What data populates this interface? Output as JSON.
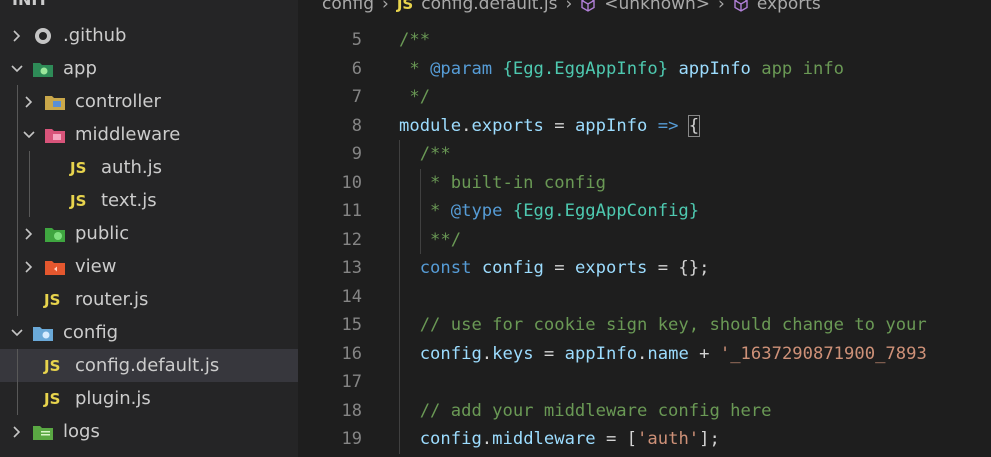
{
  "sidebar": {
    "header": "INIT",
    "items": [
      {
        "label": ".github",
        "kind": "folder",
        "icon": "github-folder-icon",
        "expanded": false,
        "depth": 0
      },
      {
        "label": "app",
        "kind": "folder",
        "icon": "app-folder-icon",
        "expanded": true,
        "depth": 0
      },
      {
        "label": "controller",
        "kind": "folder",
        "icon": "controller-folder-icon",
        "expanded": false,
        "depth": 1
      },
      {
        "label": "middleware",
        "kind": "folder",
        "icon": "middleware-folder-icon",
        "expanded": true,
        "depth": 1
      },
      {
        "label": "auth.js",
        "kind": "file",
        "icon": "js-file-icon",
        "depth": 2
      },
      {
        "label": "text.js",
        "kind": "file",
        "icon": "js-file-icon",
        "depth": 2
      },
      {
        "label": "public",
        "kind": "folder",
        "icon": "public-folder-icon",
        "expanded": false,
        "depth": 1
      },
      {
        "label": "view",
        "kind": "folder",
        "icon": "view-folder-icon",
        "expanded": false,
        "depth": 1
      },
      {
        "label": "router.js",
        "kind": "file",
        "icon": "js-file-icon",
        "depth": 1
      },
      {
        "label": "config",
        "kind": "folder",
        "icon": "config-folder-icon",
        "expanded": true,
        "depth": 0
      },
      {
        "label": "config.default.js",
        "kind": "file",
        "icon": "js-file-icon",
        "depth": 1,
        "selected": true
      },
      {
        "label": "plugin.js",
        "kind": "file",
        "icon": "js-file-icon",
        "depth": 1
      },
      {
        "label": "logs",
        "kind": "folder",
        "icon": "logs-folder-icon",
        "expanded": false,
        "depth": 0
      }
    ],
    "js_badge": "JS"
  },
  "breadcrumb": {
    "folder": "config",
    "file_badge": "JS",
    "file": "config.default.js",
    "symbol1": "<unknown>",
    "symbol2": "exports"
  },
  "editor": {
    "line_numbers": [
      "5",
      "6",
      "7",
      "8",
      "9",
      "10",
      "11",
      "12",
      "13",
      "14",
      "15",
      "16",
      "17",
      "18",
      "19"
    ],
    "lines": [
      {
        "indent": "",
        "tokens": [
          {
            "t": "/**",
            "c": "comment"
          }
        ]
      },
      {
        "indent": " ",
        "tokens": [
          {
            "t": "* ",
            "c": "comment"
          },
          {
            "t": "@param",
            "c": "tag"
          },
          {
            "t": " ",
            "c": "comment"
          },
          {
            "t": "{Egg.EggAppInfo}",
            "c": "type"
          },
          {
            "t": " ",
            "c": "comment"
          },
          {
            "t": "appInfo",
            "c": "var"
          },
          {
            "t": " app info",
            "c": "comment"
          }
        ]
      },
      {
        "indent": " ",
        "tokens": [
          {
            "t": "*/",
            "c": "comment"
          }
        ]
      },
      {
        "indent": "",
        "tokens": [
          {
            "t": "module",
            "c": "var"
          },
          {
            "t": ".",
            "c": "plain"
          },
          {
            "t": "exports",
            "c": "var"
          },
          {
            "t": " = ",
            "c": "plain"
          },
          {
            "t": "appInfo",
            "c": "var"
          },
          {
            "t": " ",
            "c": "plain"
          },
          {
            "t": "=>",
            "c": "kw"
          },
          {
            "t": " ",
            "c": "plain"
          },
          {
            "t": "{",
            "c": "brace"
          }
        ]
      },
      {
        "indent": "  ",
        "tokens": [
          {
            "t": "/**",
            "c": "comment"
          }
        ]
      },
      {
        "indent": "   ",
        "tokens": [
          {
            "t": "* built-in config",
            "c": "comment"
          }
        ]
      },
      {
        "indent": "   ",
        "tokens": [
          {
            "t": "* ",
            "c": "comment"
          },
          {
            "t": "@type",
            "c": "tag"
          },
          {
            "t": " ",
            "c": "comment"
          },
          {
            "t": "{Egg.EggAppConfig}",
            "c": "type"
          }
        ]
      },
      {
        "indent": "   ",
        "tokens": [
          {
            "t": "**/",
            "c": "comment"
          }
        ]
      },
      {
        "indent": "  ",
        "tokens": [
          {
            "t": "const",
            "c": "kw"
          },
          {
            "t": " ",
            "c": "plain"
          },
          {
            "t": "config",
            "c": "var"
          },
          {
            "t": " = ",
            "c": "plain"
          },
          {
            "t": "exports",
            "c": "var"
          },
          {
            "t": " = {};",
            "c": "plain"
          }
        ]
      },
      {
        "indent": "",
        "tokens": []
      },
      {
        "indent": "  ",
        "tokens": [
          {
            "t": "// use for cookie sign key, should change to your",
            "c": "comment"
          }
        ]
      },
      {
        "indent": "  ",
        "tokens": [
          {
            "t": "config",
            "c": "var"
          },
          {
            "t": ".",
            "c": "plain"
          },
          {
            "t": "keys",
            "c": "var"
          },
          {
            "t": " = ",
            "c": "plain"
          },
          {
            "t": "appInfo",
            "c": "var"
          },
          {
            "t": ".",
            "c": "plain"
          },
          {
            "t": "name",
            "c": "var"
          },
          {
            "t": " + ",
            "c": "plain"
          },
          {
            "t": "'_1637290871900_7893",
            "c": "str"
          }
        ]
      },
      {
        "indent": "",
        "tokens": []
      },
      {
        "indent": "  ",
        "tokens": [
          {
            "t": "// add your middleware config here",
            "c": "comment"
          }
        ]
      },
      {
        "indent": "  ",
        "tokens": [
          {
            "t": "config",
            "c": "var"
          },
          {
            "t": ".",
            "c": "plain"
          },
          {
            "t": "middleware",
            "c": "var"
          },
          {
            "t": " = [",
            "c": "plain"
          },
          {
            "t": "'auth'",
            "c": "str"
          },
          {
            "t": "];",
            "c": "plain"
          }
        ]
      }
    ]
  },
  "colors": {
    "js_yellow": "#e8d44d",
    "selected_row": "#37373d",
    "comment": "#6a9955",
    "keyword": "#569cd6",
    "type": "#4ec9b0",
    "variable": "#9cdcfe",
    "string": "#ce9178"
  }
}
